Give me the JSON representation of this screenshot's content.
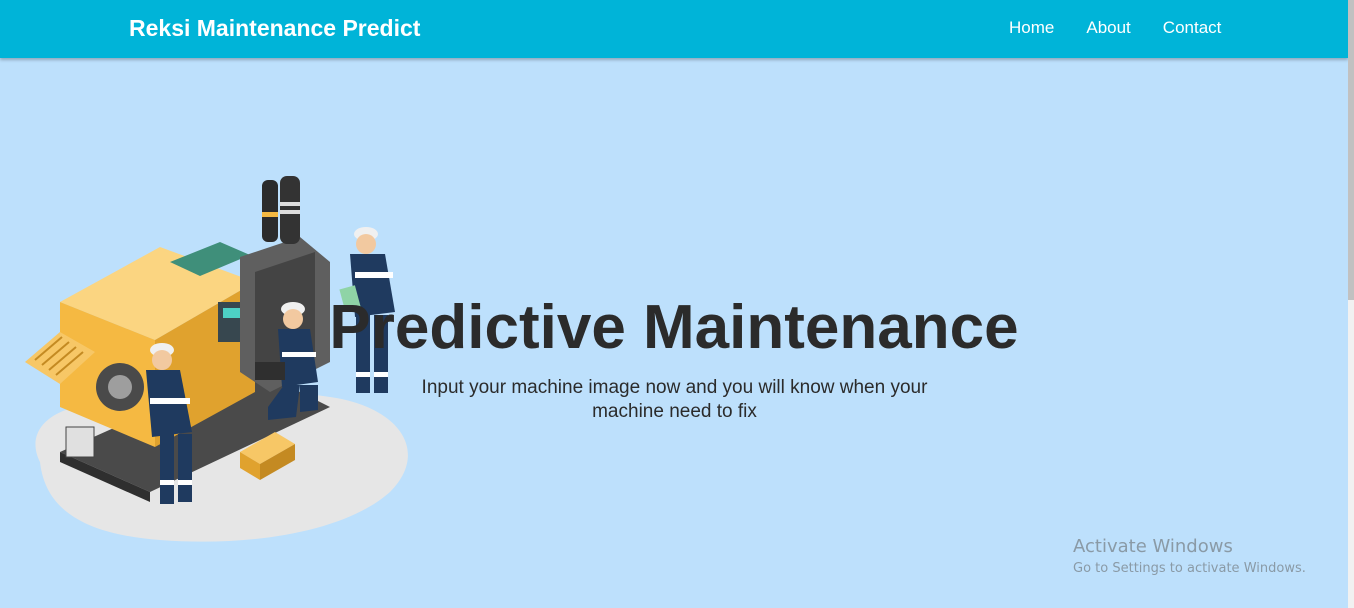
{
  "navbar": {
    "brand": "Reksi Maintenance Predict",
    "links": [
      "Home",
      "About",
      "Contact"
    ]
  },
  "hero": {
    "title": "Predictive Maintenance",
    "subtitle": "Input your machine image now and you will know when your machine need to fix"
  },
  "watermark": {
    "title": "Activate Windows",
    "subtitle": "Go to Settings to activate Windows."
  },
  "colors": {
    "navbar": "#00b4d8",
    "background": "#bde0fc",
    "text": "#2b2b2b",
    "machine": "#f5b942",
    "uniform": "#1f3a5f"
  },
  "illustration": {
    "name": "machine-maintenance-illustration"
  }
}
